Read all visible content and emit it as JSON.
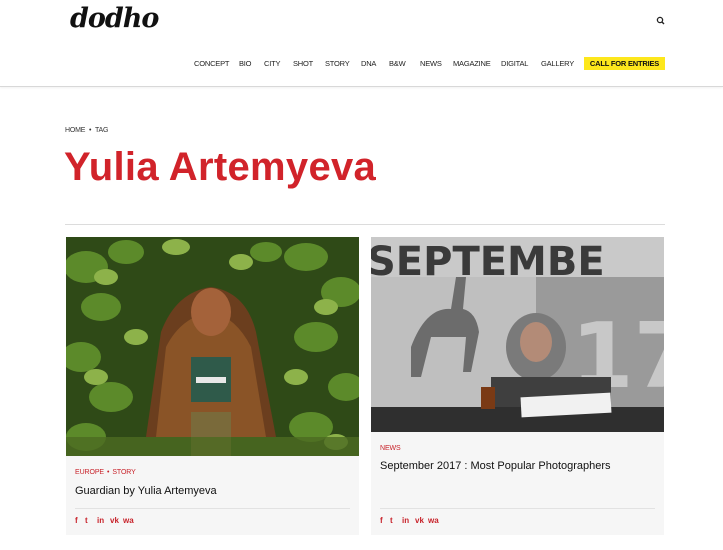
{
  "header": {
    "logo": "dodho",
    "nav": [
      "CONCEPT",
      "BIO",
      "CITY",
      "SHOT",
      "STORY",
      "DNA",
      "B&W",
      "NEWS",
      "MAGAZINE",
      "DIGITAL",
      "GALLERY"
    ],
    "cta": "CALL FOR ENTRIES"
  },
  "breadcrumb": {
    "home": "HOME",
    "sep": "•",
    "current": "TAG"
  },
  "page_title": "Yulia Artemyeva",
  "cards": [
    {
      "cat1": "EUROPE",
      "cat_sep": "•",
      "cat2": "STORY",
      "title": "Guardian by Yulia Artemyeva"
    },
    {
      "cat1": "NEWS",
      "title": "September 2017 : Most Popular Photographers",
      "img_text": "SEPTEMBE",
      "img_number": "17"
    }
  ],
  "share_icons": [
    "f",
    "t",
    "in",
    "vk",
    "wa"
  ],
  "colors": {
    "accent": "#d1232a",
    "cta_bg": "#fde71c"
  }
}
